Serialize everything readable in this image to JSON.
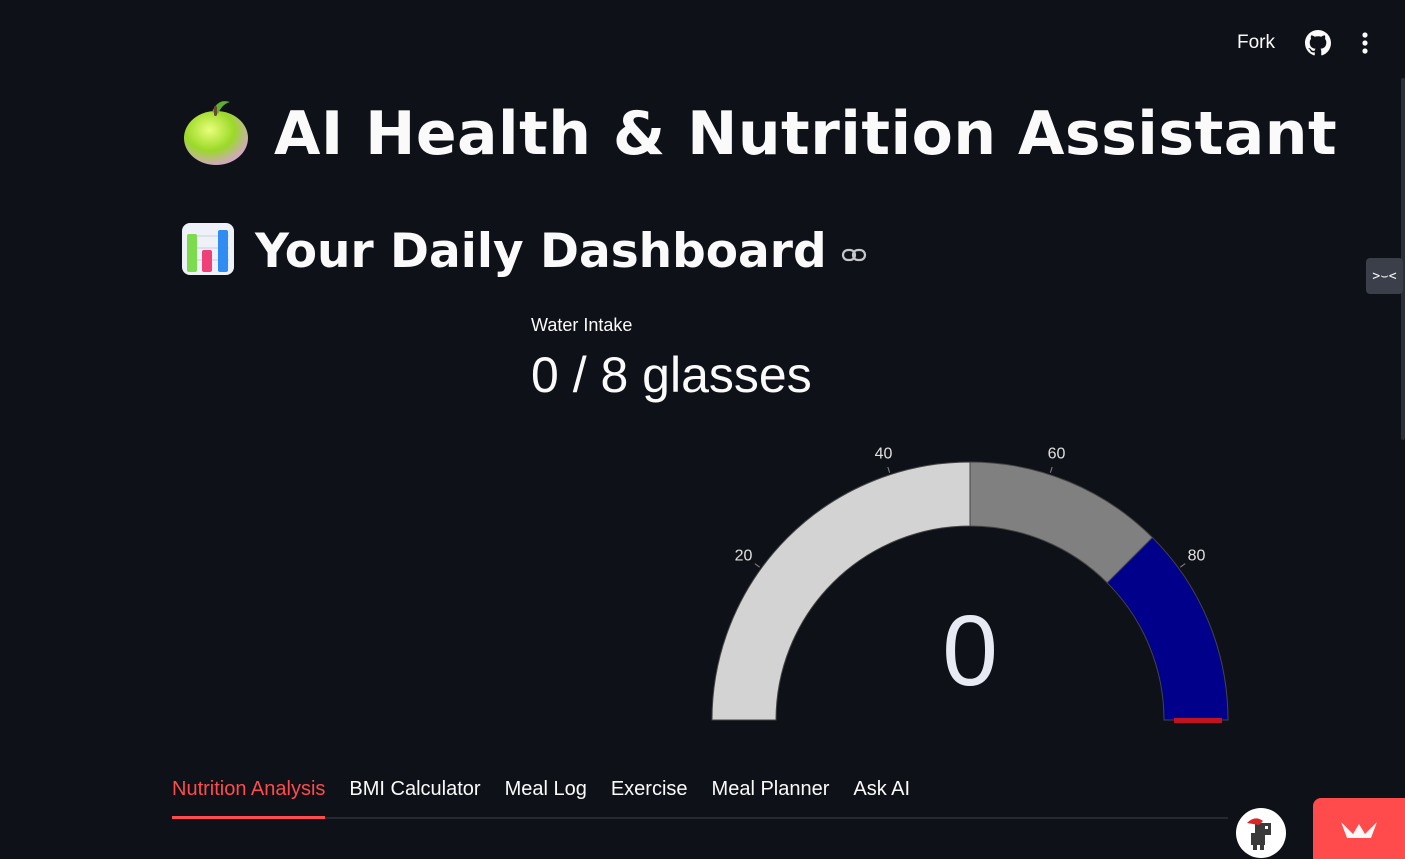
{
  "toolbar": {
    "fork_label": "Fork",
    "github_icon": "github-icon",
    "menu_icon": "more-vertical-icon"
  },
  "header": {
    "emoji_icon": "green-apple-icon",
    "title": "AI Health & Nutrition Assistant"
  },
  "dashboard": {
    "emoji_icon": "bar-chart-icon",
    "title": "Your Daily Dashboard",
    "link_icon": "link-icon"
  },
  "metric": {
    "label": "Water Intake",
    "value": "0 / 8 glasses"
  },
  "gauge": {
    "value": "0",
    "range": [
      0,
      100
    ],
    "tick_labels": [
      "20",
      "40",
      "60",
      "80"
    ],
    "steps": [
      {
        "range": [
          0,
          50
        ],
        "color": "#d3d3d3"
      },
      {
        "range": [
          50,
          75
        ],
        "color": "#808080"
      },
      {
        "range": [
          75,
          100
        ],
        "color": "#00008b"
      }
    ],
    "bar_color": "#c0131f"
  },
  "tabs": [
    {
      "label": "Nutrition Analysis",
      "active": true
    },
    {
      "label": "BMI Calculator",
      "active": false
    },
    {
      "label": "Meal Log",
      "active": false
    },
    {
      "label": "Exercise",
      "active": false
    },
    {
      "label": "Meal Planner",
      "active": false
    },
    {
      "label": "Ask AI",
      "active": false
    }
  ],
  "colors": {
    "background": "#0e1117",
    "accent": "#ff4b4b",
    "text": "#fafafa"
  }
}
